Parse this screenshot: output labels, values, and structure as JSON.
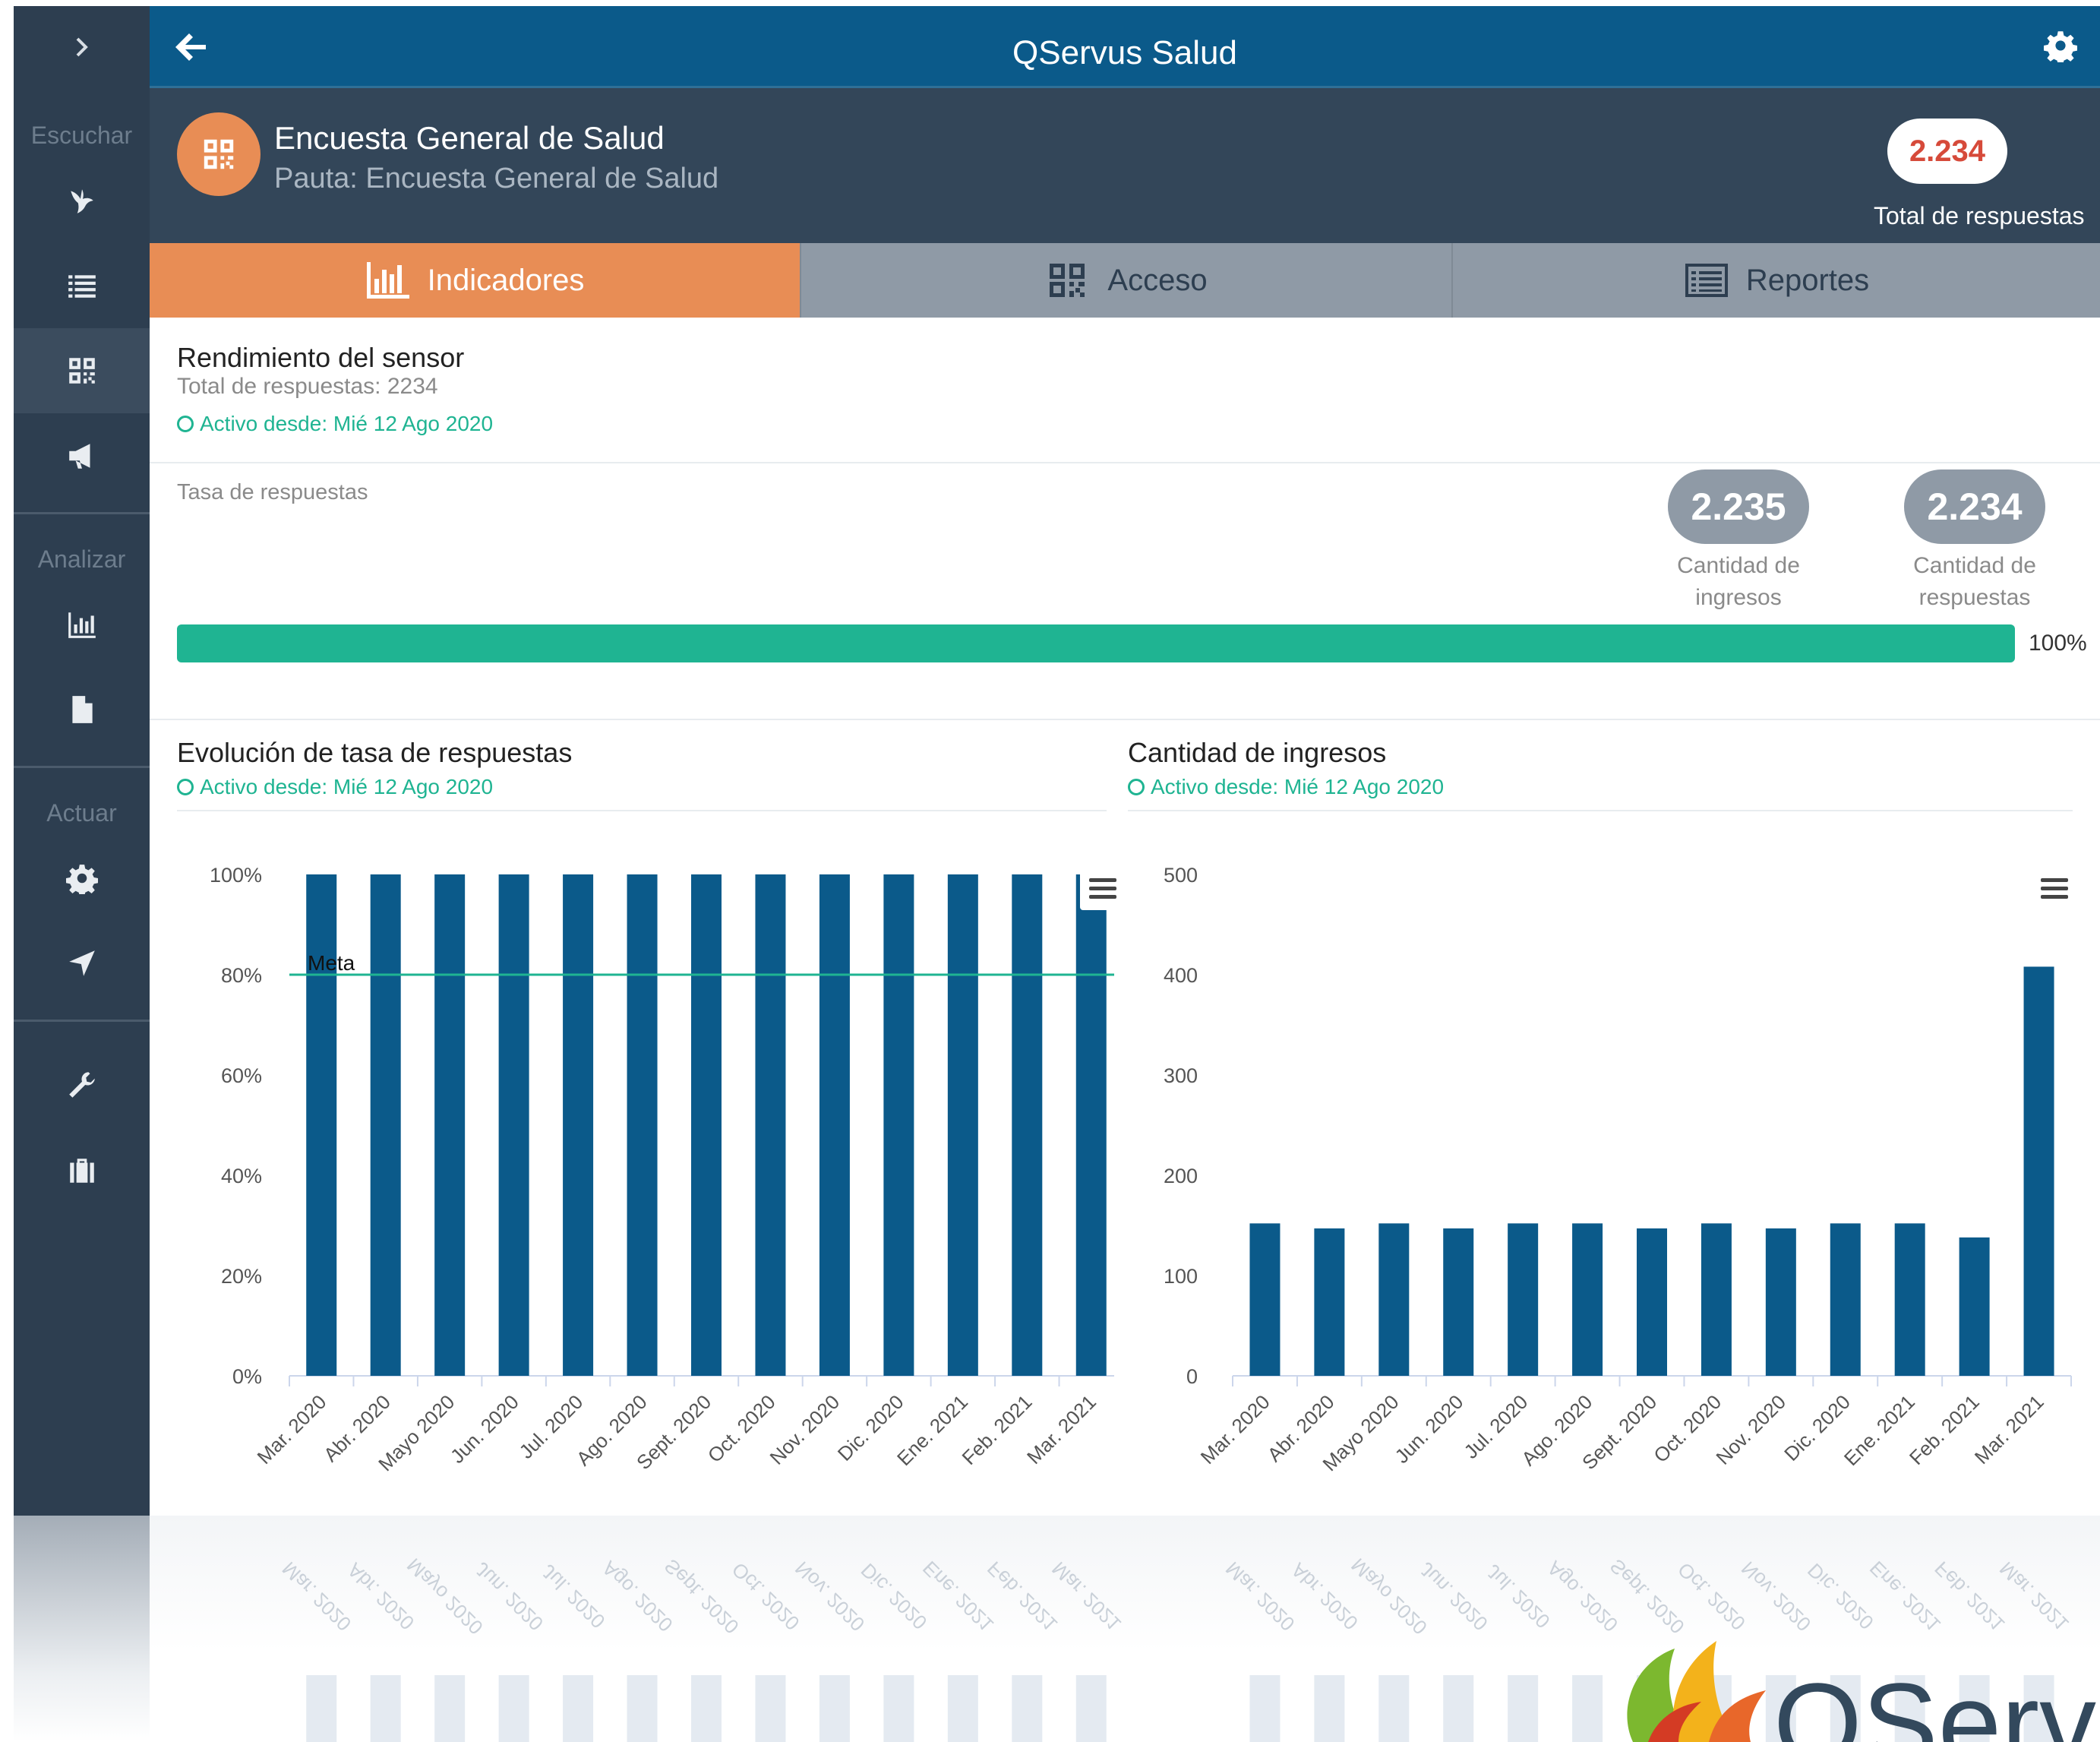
{
  "colors": {
    "sidebar": "#2d3e50",
    "header": "#0b5a8a",
    "accent": "#e88d55",
    "success": "#1fb492",
    "bar": "#0b5a8a",
    "badge_red": "#d64a3a"
  },
  "sidebar": {
    "toggle_icon": "chevron-right-icon",
    "sections": [
      {
        "label": "Escuchar",
        "items": [
          {
            "icon": "bird-icon"
          },
          {
            "icon": "list-icon"
          },
          {
            "icon": "qr-code-icon",
            "active": true
          },
          {
            "icon": "megaphone-icon"
          }
        ]
      },
      {
        "label": "Analizar",
        "items": [
          {
            "icon": "bar-chart-icon"
          },
          {
            "icon": "document-icon"
          }
        ]
      },
      {
        "label": "Actuar",
        "items": [
          {
            "icon": "gear-icon"
          },
          {
            "icon": "location-arrow-icon"
          }
        ]
      },
      {
        "label": "",
        "items": [
          {
            "icon": "wrench-icon"
          },
          {
            "icon": "briefcase-icon"
          }
        ]
      }
    ]
  },
  "header": {
    "title": "QServus Salud"
  },
  "survey": {
    "title": "Encuesta General de Salud",
    "subtitle": "Pauta: Encuesta General de Salud",
    "total_value": "2.234",
    "total_label": "Total de respuestas"
  },
  "tabs": [
    {
      "label": "Indicadores",
      "icon": "bar-chart-icon",
      "active": true
    },
    {
      "label": "Acceso",
      "icon": "qr-code-icon",
      "active": false
    },
    {
      "label": "Reportes",
      "icon": "report-list-icon",
      "active": false
    }
  ],
  "performance": {
    "title": "Rendimiento del sensor",
    "total": "Total de respuestas: 2234",
    "active_since": "Activo desde: Mié 12 Ago 2020"
  },
  "rate": {
    "label": "Tasa de respuestas",
    "ingresos_value": "2.235",
    "ingresos_label_1": "Cantidad de",
    "ingresos_label_2": "ingresos",
    "respuestas_value": "2.234",
    "respuestas_label_1": "Cantidad de",
    "respuestas_label_2": "respuestas",
    "progress": 100,
    "progress_label": "100%"
  },
  "chart_left_header": {
    "title": "Evolución de tasa de respuestas",
    "active_since": "Activo desde: Mié 12 Ago 2020"
  },
  "chart_right_header": {
    "title": "Cantidad de ingresos",
    "active_since": "Activo desde: Mié 12 Ago 2020"
  },
  "chart_data": [
    {
      "type": "bar",
      "title": "Evolución de tasa de respuestas",
      "categories": [
        "Mar. 2020",
        "Abr. 2020",
        "Mayo 2020",
        "Jun. 2020",
        "Jul. 2020",
        "Ago. 2020",
        "Sept. 2020",
        "Oct. 2020",
        "Nov. 2020",
        "Dic. 2020",
        "Ene. 2021",
        "Feb. 2021",
        "Mar. 2021"
      ],
      "values": [
        100,
        100,
        100,
        100,
        100,
        100,
        100,
        100,
        100,
        100,
        100,
        100,
        100
      ],
      "ylim": [
        0,
        100
      ],
      "yticks": [
        "0%",
        "20%",
        "40%",
        "60%",
        "80%",
        "100%"
      ],
      "ytick_values": [
        0,
        20,
        40,
        60,
        80,
        100
      ],
      "goal": {
        "label": "Meta",
        "value": 80
      },
      "grid": false
    },
    {
      "type": "bar",
      "title": "Cantidad de ingresos",
      "categories": [
        "Mar. 2020",
        "Abr. 2020",
        "Mayo 2020",
        "Jun. 2020",
        "Jul. 2020",
        "Ago. 2020",
        "Sept. 2020",
        "Oct. 2020",
        "Nov. 2020",
        "Dic. 2020",
        "Ene. 2021",
        "Feb. 2021",
        "Mar. 2021"
      ],
      "values": [
        152,
        147,
        152,
        147,
        152,
        152,
        147,
        152,
        147,
        152,
        152,
        138,
        408
      ],
      "ylim": [
        0,
        500
      ],
      "yticks": [
        "0",
        "100",
        "200",
        "300",
        "400",
        "500"
      ],
      "ytick_values": [
        0,
        100,
        200,
        300,
        400,
        500
      ],
      "grid": false
    }
  ]
}
